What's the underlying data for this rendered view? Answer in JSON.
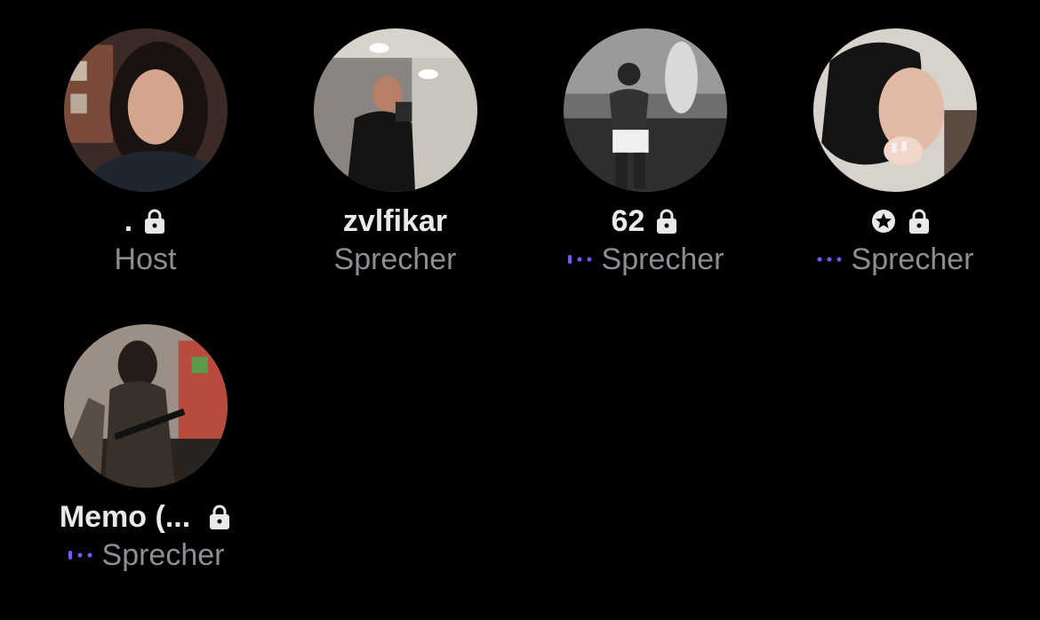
{
  "colors": {
    "background": "#000000",
    "name_text": "#e7e9ea",
    "role_text": "#8b8f94",
    "speaking_accent": "#7856ff"
  },
  "participants": [
    {
      "name": ".",
      "role": "Host",
      "speaking": false,
      "badge_icon": null,
      "locked": true,
      "avatar_icon": "avatar-woman-selfie"
    },
    {
      "name": "zvlfikar",
      "role": "Sprecher",
      "speaking": false,
      "badge_icon": null,
      "locked": false,
      "avatar_icon": "avatar-man-mirror-selfie"
    },
    {
      "name": "62",
      "role": "Sprecher",
      "speaking": true,
      "badge_icon": null,
      "locked": true,
      "avatar_icon": "avatar-boxer-photo"
    },
    {
      "name": "",
      "role": "Sprecher",
      "speaking": true,
      "badge_icon": "star-circle-icon",
      "locked": true,
      "avatar_icon": "avatar-woman-surprised"
    },
    {
      "name": "Memo (...",
      "role": "Sprecher",
      "speaking": true,
      "badge_icon": null,
      "locked": true,
      "avatar_icon": "avatar-hooded-figure"
    }
  ]
}
